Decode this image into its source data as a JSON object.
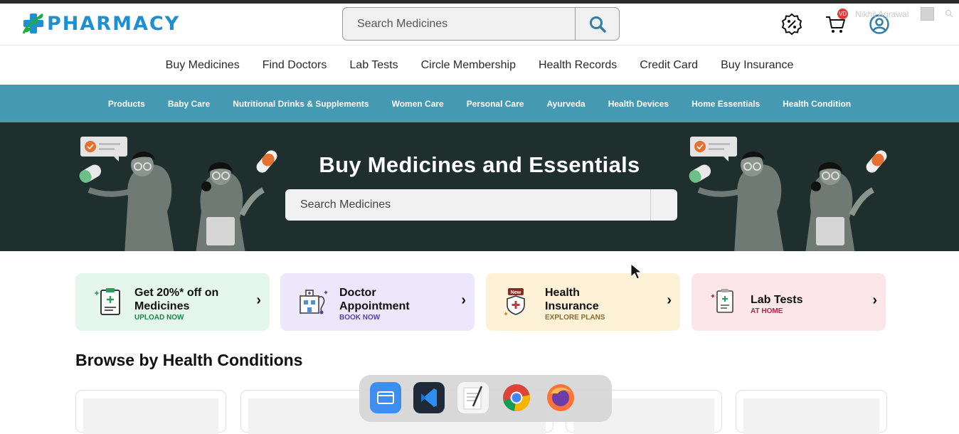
{
  "header": {
    "logo_text": "PHARMACY",
    "search_placeholder": "Search Medicines",
    "cart_badge": "VD",
    "username": "Nikhil Agrawal"
  },
  "nav": {
    "items": [
      "Buy Medicines",
      "Find Doctors",
      "Lab Tests",
      "Circle Membership",
      "Health Records",
      "Credit Card",
      "Buy Insurance"
    ]
  },
  "categories": {
    "items": [
      "Products",
      "Baby Care",
      "Nutritional Drinks & Supplements",
      "Women Care",
      "Personal Care",
      "Ayurveda",
      "Health Devices",
      "Home Essentials",
      "Health Condition"
    ]
  },
  "hero": {
    "title": "Buy Medicines and Essentials",
    "search_placeholder": "Search Medicines"
  },
  "services": [
    {
      "title_line1": "Get 20%* off on",
      "title_line2": "Medicines",
      "sub": "UPLOAD NOW",
      "bg": "#e5f6ec",
      "sub_color": "#178a44"
    },
    {
      "title_line1": "Doctor",
      "title_line2": "Appointment",
      "sub": "BOOK NOW",
      "bg": "#ece7fb",
      "sub_color": "#5a3fb0"
    },
    {
      "title_line1": "Health",
      "title_line2": "Insurance",
      "sub": "EXPLORE PLANS",
      "bg": "#fdf1d7",
      "sub_color": "#8a6d2d"
    },
    {
      "title_line1": "Lab Tests",
      "title_line2": "",
      "sub": "AT HOME",
      "bg": "#fbe6ea",
      "sub_color": "#b3264a"
    }
  ],
  "insurance_badge": "New",
  "section": {
    "title": "Browse by Health Conditions"
  },
  "dock": {
    "apps": [
      "files-app",
      "vscode-app",
      "text-editor-app",
      "chrome-app",
      "firefox-app"
    ]
  },
  "colors": {
    "brand_blue": "#1e8fd1",
    "category_bar": "#4599b3",
    "hero_bg": "#1f2f2e"
  }
}
